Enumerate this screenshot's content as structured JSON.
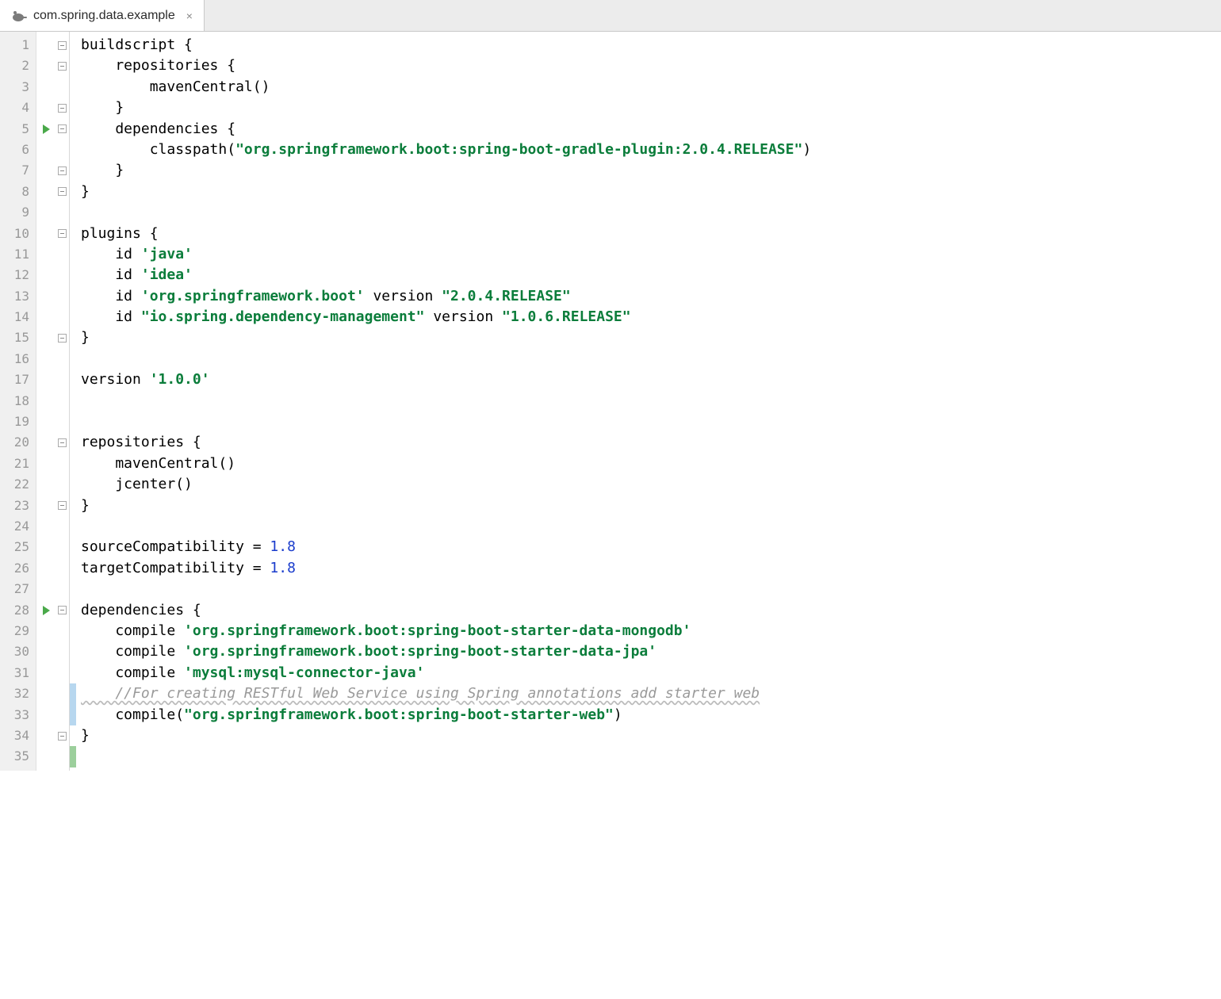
{
  "tab": {
    "title": "com.spring.data.example",
    "close": "×"
  },
  "runMarkers": {
    "lines": [
      5,
      28
    ]
  },
  "foldMarkers": {
    "open": [
      1,
      2,
      5,
      8,
      10,
      15,
      20,
      23,
      28,
      34
    ],
    "close": [
      4,
      7
    ]
  },
  "modMarkers": {
    "blue": [
      32,
      33
    ],
    "green": [
      35
    ]
  },
  "code": {
    "l1": "buildscript {",
    "l2a": "    repositories {",
    "l3": "        mavenCentral()",
    "l4": "    }",
    "l5": "    dependencies {",
    "l6a": "        classpath(",
    "l6s": "\"org.springframework.boot:spring-boot-gradle-plugin:2.0.4.RELEASE\"",
    "l6b": ")",
    "l7": "    }",
    "l8": "}",
    "l9": "",
    "l10": "plugins {",
    "l11a": "    id ",
    "l11s": "'java'",
    "l12a": "    id ",
    "l12s": "'idea'",
    "l13a": "    id ",
    "l13s": "'org.springframework.boot'",
    "l13b": " version ",
    "l13v": "\"2.0.4.RELEASE\"",
    "l14a": "    id ",
    "l14s": "\"io.spring.dependency-management\"",
    "l14b": " version ",
    "l14v": "\"1.0.6.RELEASE\"",
    "l15": "}",
    "l16": "",
    "l17a": "version ",
    "l17s": "'1.0.0'",
    "l18": "",
    "l19": "",
    "l20": "repositories {",
    "l21": "    mavenCentral()",
    "l22": "    jcenter()",
    "l23": "}",
    "l24": "",
    "l25a": "sourceCompatibility = ",
    "l25n": "1.8",
    "l26a": "targetCompatibility = ",
    "l26n": "1.8",
    "l27": "",
    "l28": "dependencies {",
    "l29a": "    compile ",
    "l29s": "'org.springframework.boot:spring-boot-starter-data-mongodb'",
    "l30a": "    compile ",
    "l30s": "'org.springframework.boot:spring-boot-starter-data-jpa'",
    "l31a": "    compile ",
    "l31s": "'mysql:mysql-connector-java'",
    "l32c": "    //For creating RESTful Web Service using Spring annotations add starter web",
    "l33a": "    compile(",
    "l33s": "\"org.springframework.boot:spring-boot-starter-web\"",
    "l33b": ")",
    "l34": "}",
    "l35": ""
  },
  "lineCount": 35
}
